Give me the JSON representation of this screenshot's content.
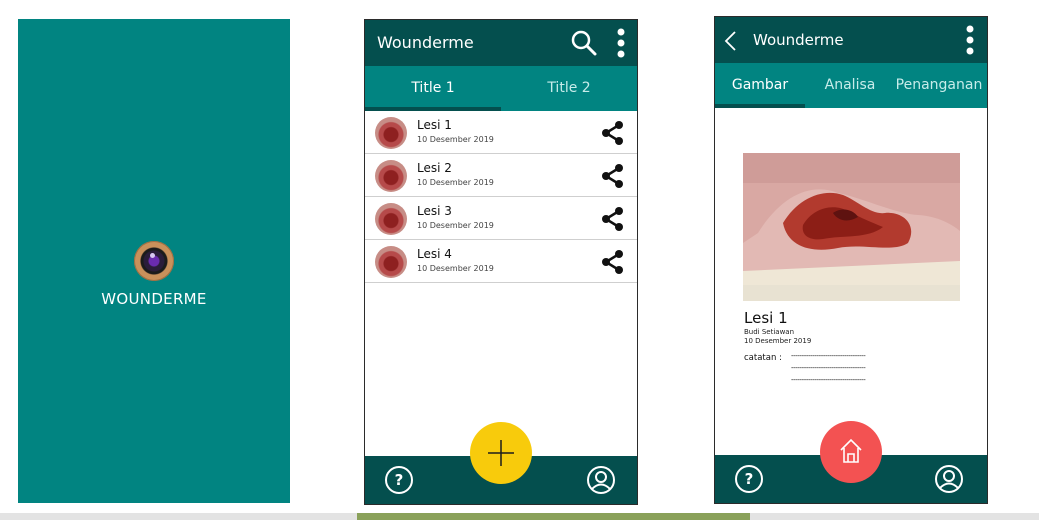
{
  "splash": {
    "brand": "WOUNDERME"
  },
  "list_screen": {
    "title": "Wounderme",
    "tabs": [
      {
        "label": "Title 1"
      },
      {
        "label": "Title 2"
      }
    ],
    "items": [
      {
        "title": "Lesi 1",
        "date": "10 Desember 2019"
      },
      {
        "title": "Lesi 2",
        "date": "10 Desember 2019"
      },
      {
        "title": "Lesi 3",
        "date": "10 Desember 2019"
      },
      {
        "title": "Lesi 4",
        "date": "10 Desember 2019"
      }
    ],
    "fab": "+"
  },
  "detail_screen": {
    "title": "Wounderme",
    "tabs": [
      {
        "label": "Gambar"
      },
      {
        "label": "Analisa"
      },
      {
        "label": "Penanganan"
      }
    ],
    "lesion": {
      "title": "Lesi 1",
      "patient": "Budi Setiawan",
      "date": "10 Desember 2019"
    },
    "notes_label": "catatan :",
    "notes_lines": [
      "-----------------------------------",
      "-----------------------------------",
      "-----------------------------------"
    ]
  },
  "help_glyph": "?",
  "colors": {
    "teal": "#018481",
    "dark_teal": "#044f4e",
    "fab_yellow": "#f8cb0c",
    "home_red": "#f35252"
  }
}
